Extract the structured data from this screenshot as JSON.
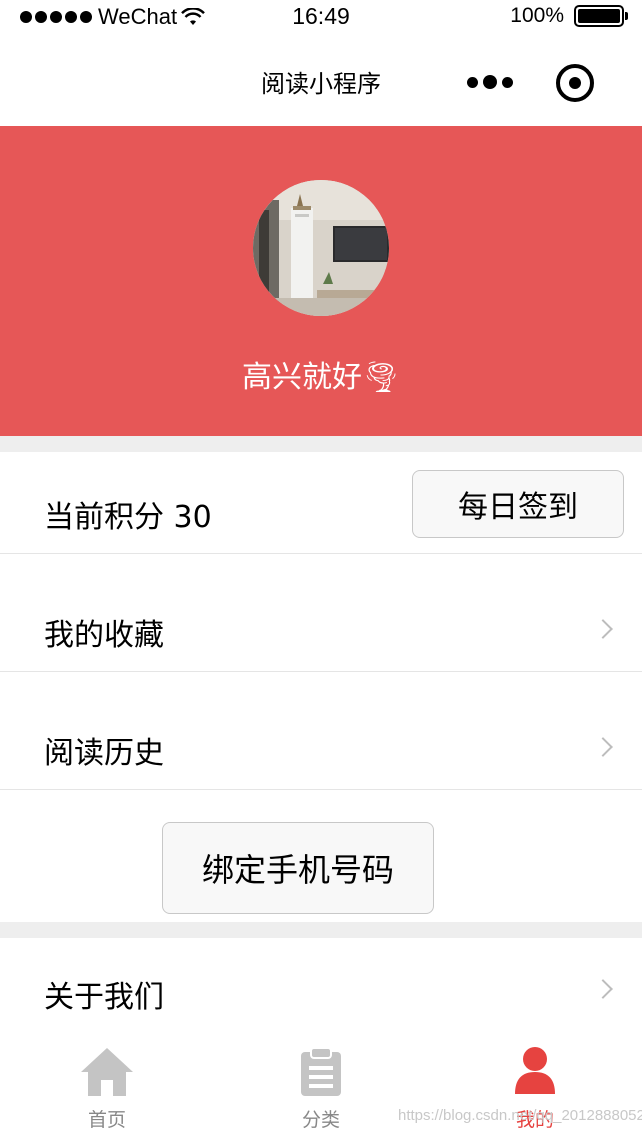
{
  "status_bar": {
    "carrier": "WeChat",
    "time": "16:49",
    "battery_percent": "100%",
    "battery_level": 1.0
  },
  "nav": {
    "title": "阅读小程序",
    "more_icon": "more-dots-icon",
    "close_icon": "target-close-icon"
  },
  "profile": {
    "avatar_icon": "avatar-photo",
    "nickname": "高兴就好🌪"
  },
  "points": {
    "label": "当前积分 30",
    "checkin_button": "每日签到"
  },
  "menu": {
    "favorites": "我的收藏",
    "history": "阅读历史",
    "bind_phone_button": "绑定手机号码",
    "about": "关于我们"
  },
  "tabs": [
    {
      "label": "首页",
      "icon": "home-icon",
      "active": false
    },
    {
      "label": "分类",
      "icon": "clipboard-list-icon",
      "active": false
    },
    {
      "label": "我的",
      "icon": "user-icon",
      "active": true
    }
  ],
  "colors": {
    "header_bg": "#e65757",
    "active_tab": "#e64340",
    "inactive_tab": "#888888",
    "divider_bg": "#eeeeee"
  },
  "watermark": "https://blog.csdn.net/qq_2012888052"
}
